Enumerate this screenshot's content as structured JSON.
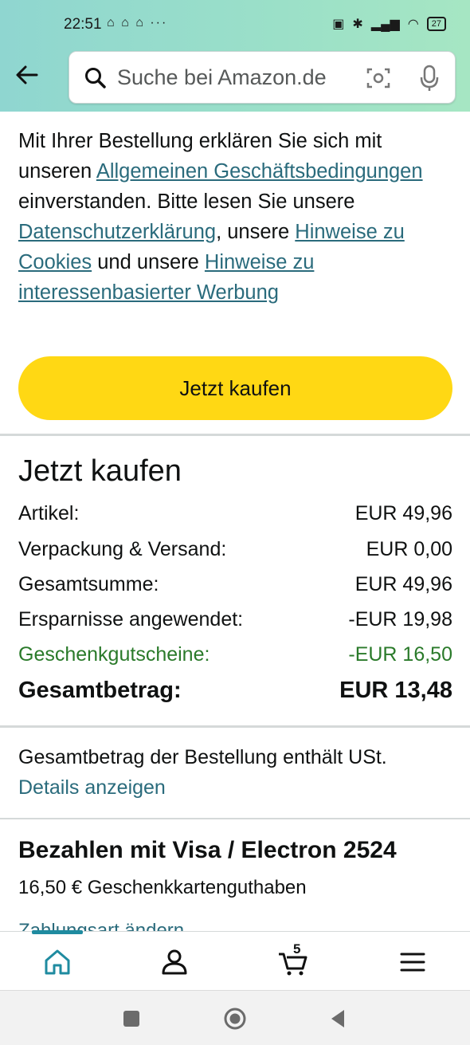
{
  "status_bar": {
    "time": "22:51",
    "notifications": "⌂ ⌂ ⌂  ···",
    "battery": "27"
  },
  "header": {
    "search_placeholder": "Suche bei Amazon.de"
  },
  "legal": {
    "t1": "Mit Ihrer Bestellung erklären Sie sich mit unseren ",
    "link_terms": "Allgemeinen Geschäftsbedingungen",
    "t2": " einverstanden. Bitte lesen Sie unsere ",
    "link_privacy": "Datenschutzerklärung",
    "t3": ", unsere ",
    "link_cookies": "Hinweise zu Cookies",
    "t4": " und unsere ",
    "link_ads": "Hinweise zu interessenbasierter Werbung"
  },
  "buy_button": {
    "label": "Jetzt kaufen"
  },
  "summary": {
    "title": "Jetzt kaufen",
    "rows": [
      {
        "label": "Artikel:",
        "value": "EUR 49,96"
      },
      {
        "label": "Verpackung & Versand:",
        "value": "EUR 0,00"
      },
      {
        "label": "Gesamtsumme:",
        "value": "EUR 49,96"
      },
      {
        "label": "Ersparnisse angewendet:",
        "value": "-EUR 19,98"
      },
      {
        "label": "Geschenkgutscheine:",
        "value": "-EUR 16,50"
      },
      {
        "label": "Gesamtbetrag:",
        "value": "EUR 13,48"
      }
    ]
  },
  "vat": {
    "text": "Gesamtbetrag der Bestellung enthält USt.",
    "details_link": "Details anzeigen"
  },
  "payment": {
    "title": "Bezahlen mit Visa / Electron 2524",
    "subtitle": "16,50 € Geschenkkartenguthaben",
    "cutoff_link": "Zahlungsart ändern"
  },
  "bottom_nav": {
    "cart_count": "5",
    "items": [
      "home-icon",
      "account-icon",
      "cart-icon",
      "menu-icon"
    ]
  },
  "colors": {
    "accent": "#2a6b7c",
    "button": "#ffd814",
    "green": "#2a7a2a"
  }
}
